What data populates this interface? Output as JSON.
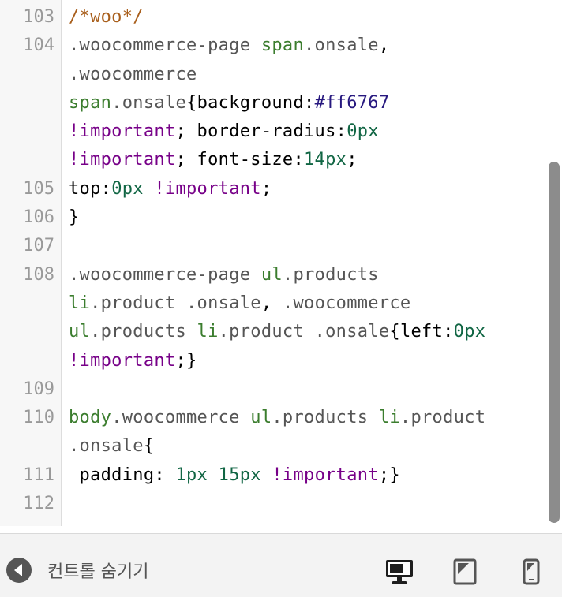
{
  "editor": {
    "lines": [
      {
        "number": "103",
        "rows": [
          [
            {
              "t": "/*woo*/",
              "c": "comment"
            }
          ]
        ]
      },
      {
        "number": "104",
        "rows": [
          [
            {
              "t": ".woocommerce-page",
              "c": "qualifier"
            },
            {
              "t": " ",
              "c": "plain"
            },
            {
              "t": "span",
              "c": "tag"
            },
            {
              "t": ".onsale",
              "c": "qualifier"
            },
            {
              "t": ",",
              "c": "punct"
            }
          ],
          [
            {
              "t": ".woocommerce",
              "c": "qualifier"
            }
          ],
          [
            {
              "t": "span",
              "c": "tag"
            },
            {
              "t": ".onsale",
              "c": "qualifier"
            },
            {
              "t": "{",
              "c": "punct"
            },
            {
              "t": "background",
              "c": "property"
            },
            {
              "t": ":",
              "c": "punct"
            },
            {
              "t": "#ff6767",
              "c": "builtin"
            }
          ],
          [
            {
              "t": "!important",
              "c": "important"
            },
            {
              "t": "; ",
              "c": "punct"
            },
            {
              "t": "border-radius",
              "c": "property"
            },
            {
              "t": ":",
              "c": "punct"
            },
            {
              "t": "0px",
              "c": "number"
            }
          ],
          [
            {
              "t": "!important",
              "c": "important"
            },
            {
              "t": "; ",
              "c": "punct"
            },
            {
              "t": "font-size",
              "c": "property"
            },
            {
              "t": ":",
              "c": "punct"
            },
            {
              "t": "14px",
              "c": "number"
            },
            {
              "t": ";",
              "c": "punct"
            }
          ]
        ]
      },
      {
        "number": "105",
        "rows": [
          [
            {
              "t": "top",
              "c": "property"
            },
            {
              "t": ":",
              "c": "punct"
            },
            {
              "t": "0px",
              "c": "number"
            },
            {
              "t": " ",
              "c": "plain"
            },
            {
              "t": "!important",
              "c": "important"
            },
            {
              "t": ";",
              "c": "punct"
            }
          ]
        ]
      },
      {
        "number": "106",
        "rows": [
          [
            {
              "t": "}",
              "c": "punct"
            }
          ]
        ]
      },
      {
        "number": "107",
        "rows": [
          [
            {
              "t": "",
              "c": "plain"
            }
          ]
        ]
      },
      {
        "number": "108",
        "rows": [
          [
            {
              "t": ".woocommerce-page",
              "c": "qualifier"
            },
            {
              "t": " ",
              "c": "plain"
            },
            {
              "t": "ul",
              "c": "tag"
            },
            {
              "t": ".products",
              "c": "qualifier"
            }
          ],
          [
            {
              "t": "li",
              "c": "tag"
            },
            {
              "t": ".product",
              "c": "qualifier"
            },
            {
              "t": " ",
              "c": "plain"
            },
            {
              "t": ".onsale",
              "c": "qualifier"
            },
            {
              "t": ", ",
              "c": "punct"
            },
            {
              "t": ".woocommerce",
              "c": "qualifier"
            }
          ],
          [
            {
              "t": "ul",
              "c": "tag"
            },
            {
              "t": ".products",
              "c": "qualifier"
            },
            {
              "t": " ",
              "c": "plain"
            },
            {
              "t": "li",
              "c": "tag"
            },
            {
              "t": ".product",
              "c": "qualifier"
            },
            {
              "t": " ",
              "c": "plain"
            },
            {
              "t": ".onsale",
              "c": "qualifier"
            },
            {
              "t": "{",
              "c": "punct"
            },
            {
              "t": "left",
              "c": "property"
            },
            {
              "t": ":",
              "c": "punct"
            },
            {
              "t": "0px",
              "c": "number"
            }
          ],
          [
            {
              "t": "!important",
              "c": "important"
            },
            {
              "t": ";}",
              "c": "punct"
            }
          ]
        ]
      },
      {
        "number": "109",
        "rows": [
          [
            {
              "t": "",
              "c": "plain"
            }
          ]
        ]
      },
      {
        "number": "110",
        "rows": [
          [
            {
              "t": "body",
              "c": "tag"
            },
            {
              "t": ".woocommerce",
              "c": "qualifier"
            },
            {
              "t": " ",
              "c": "plain"
            },
            {
              "t": "ul",
              "c": "tag"
            },
            {
              "t": ".products",
              "c": "qualifier"
            },
            {
              "t": " ",
              "c": "plain"
            },
            {
              "t": "li",
              "c": "tag"
            },
            {
              "t": ".product",
              "c": "qualifier"
            }
          ],
          [
            {
              "t": ".onsale",
              "c": "qualifier"
            },
            {
              "t": "{",
              "c": "punct"
            }
          ]
        ]
      },
      {
        "number": "111",
        "rows": [
          [
            {
              "t": " padding",
              "c": "property"
            },
            {
              "t": ": ",
              "c": "punct"
            },
            {
              "t": "1px",
              "c": "number"
            },
            {
              "t": " ",
              "c": "plain"
            },
            {
              "t": "15px",
              "c": "number"
            },
            {
              "t": " ",
              "c": "plain"
            },
            {
              "t": "!important",
              "c": "important"
            },
            {
              "t": ";}",
              "c": "punct"
            }
          ]
        ]
      },
      {
        "number": "112",
        "rows": [
          [
            {
              "t": "",
              "c": "plain"
            }
          ]
        ]
      }
    ]
  },
  "footer": {
    "toggle_label": "컨트롤 숨기기",
    "toggle_icon": "triangle-left-icon",
    "devices": [
      {
        "name": "desktop-preview",
        "icon": "monitor-icon",
        "active": true
      },
      {
        "name": "tablet-preview",
        "icon": "tablet-icon",
        "active": false
      },
      {
        "name": "mobile-preview",
        "icon": "phone-icon",
        "active": false
      }
    ]
  },
  "colors": {
    "comment": "#a85e1b",
    "qualifier": "#555555",
    "tag": "#3b7d2e",
    "builtin": "#27187f",
    "important": "#770088",
    "number": "#116644",
    "property": "#000000",
    "footer_bg": "#f3f3f3",
    "icon_active": "#1d1d1d",
    "icon_inactive": "#555555"
  }
}
